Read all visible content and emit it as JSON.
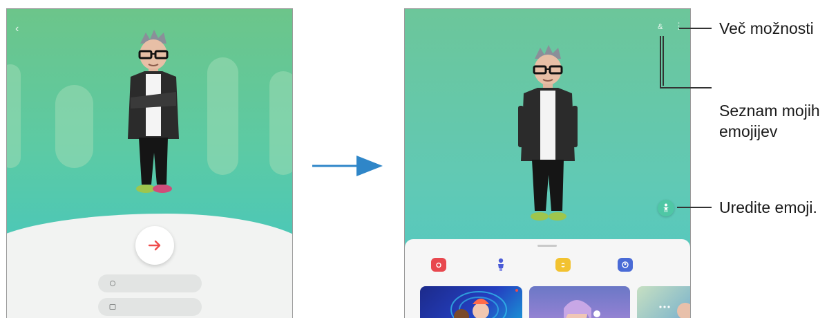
{
  "left_screen": {
    "back_icon": "chevron-left-icon",
    "subtitle": "",
    "next_icon": "arrow-right-icon",
    "buttons": [
      {
        "icon": "face-icon",
        "label": ""
      },
      {
        "icon": "image-icon",
        "label": ""
      }
    ]
  },
  "right_screen": {
    "app_title": "",
    "bottom_sheet": {
      "categories": [
        {
          "icon": "camera-icon",
          "label": "",
          "color": "#e8484f"
        },
        {
          "icon": "doll-icon",
          "label": "",
          "color": "#4a5bd6"
        },
        {
          "icon": "sticker-icon",
          "label": "",
          "color": "#f2c230"
        },
        {
          "icon": "profile-icon",
          "label": "",
          "color": "#4a6bd6"
        }
      ]
    }
  },
  "callouts": {
    "more_options": "Več možnosti",
    "my_emojis_line1": "Seznam mojih",
    "my_emojis_line2": "emojijev",
    "edit_emoji": "Uredite emoji."
  },
  "colors": {
    "accent_red": "#ef4b4b",
    "arrow": "#2f86c8"
  }
}
